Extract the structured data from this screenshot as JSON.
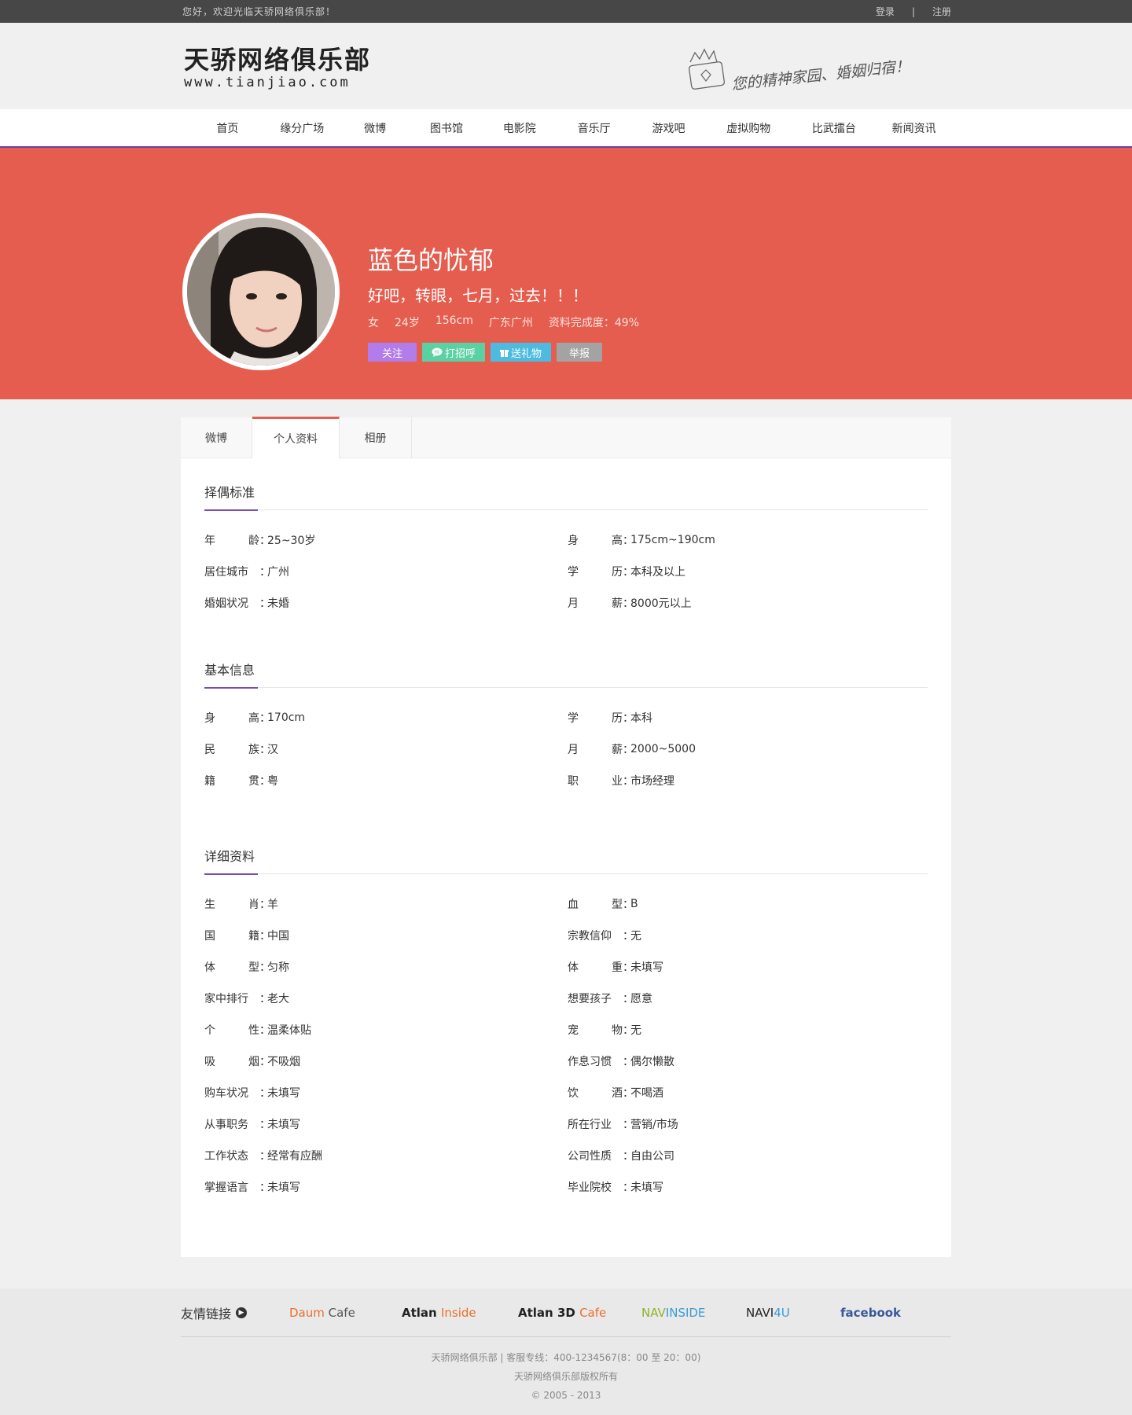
{
  "topbar": {
    "welcome": "您好，欢迎光临天骄网络俱乐部！",
    "login": "登录",
    "separator": "|",
    "register": "注册"
  },
  "header": {
    "logo_title": "天骄网络俱乐部",
    "logo_url": "www.tianjiao.com",
    "slogan": "您的精神家园、婚姻归宿！"
  },
  "nav": [
    "首页",
    "缘分广场",
    "微博",
    "图书馆",
    "电影院",
    "音乐厅",
    "游戏吧",
    "虚拟购物",
    "比武擂台",
    "新闻资讯"
  ],
  "profile": {
    "nickname": "蓝色的忧郁",
    "motto": "好吧，转眼，七月，过去！！！",
    "gender": "女",
    "age": "24岁",
    "height": "156cm",
    "location": "广东广州",
    "completeness": "资料完成度：49%",
    "actions": {
      "follow": "关注",
      "greet": "打招呼",
      "gift": "送礼物",
      "report": "举报"
    }
  },
  "tabs": [
    "微博",
    "个人资料",
    "相册"
  ],
  "sections": [
    {
      "title": "择偶标准",
      "items": [
        {
          "k": [
            "年",
            "龄"
          ],
          "v": "25~30岁"
        },
        {
          "k": [
            "身",
            "高"
          ],
          "v": "175cm~190cm"
        },
        {
          "k": [
            "居住城市"
          ],
          "v": "广州"
        },
        {
          "k": [
            "学",
            "历"
          ],
          "v": "本科及以上"
        },
        {
          "k": [
            "婚姻状况"
          ],
          "v": "未婚"
        },
        {
          "k": [
            "月",
            "薪"
          ],
          "v": "8000元以上"
        }
      ]
    },
    {
      "title": "基本信息",
      "items": [
        {
          "k": [
            "身",
            "高"
          ],
          "v": "170cm"
        },
        {
          "k": [
            "学",
            "历"
          ],
          "v": "本科"
        },
        {
          "k": [
            "民",
            "族"
          ],
          "v": "汉"
        },
        {
          "k": [
            "月",
            "薪"
          ],
          "v": "2000~5000"
        },
        {
          "k": [
            "籍",
            "贯"
          ],
          "v": "粤"
        },
        {
          "k": [
            "职",
            "业"
          ],
          "v": "市场经理"
        }
      ]
    },
    {
      "title": "详细资料",
      "items": [
        {
          "k": [
            "生",
            "肖"
          ],
          "v": "羊"
        },
        {
          "k": [
            "血",
            "型"
          ],
          "v": "B"
        },
        {
          "k": [
            "国",
            "籍"
          ],
          "v": "中国"
        },
        {
          "k": [
            "宗教信仰"
          ],
          "v": "无"
        },
        {
          "k": [
            "体",
            "型"
          ],
          "v": "匀称"
        },
        {
          "k": [
            "体",
            "重"
          ],
          "v": "未填写"
        },
        {
          "k": [
            "家中排行"
          ],
          "v": "老大"
        },
        {
          "k": [
            "想要孩子"
          ],
          "v": "愿意"
        },
        {
          "k": [
            "个",
            "性"
          ],
          "v": "温柔体贴"
        },
        {
          "k": [
            "宠",
            "物"
          ],
          "v": "无"
        },
        {
          "k": [
            "吸",
            "烟"
          ],
          "v": "不吸烟"
        },
        {
          "k": [
            "作息习惯"
          ],
          "v": "偶尔懒散"
        },
        {
          "k": [
            "购车状况"
          ],
          "v": "未填写"
        },
        {
          "k": [
            "饮",
            "酒"
          ],
          "v": "不喝酒"
        },
        {
          "k": [
            "从事职务"
          ],
          "v": "未填写"
        },
        {
          "k": [
            "所在行业"
          ],
          "v": "营销/市场"
        },
        {
          "k": [
            "工作状态"
          ],
          "v": "经常有应酬"
        },
        {
          "k": [
            "公司性质"
          ],
          "v": "自由公司"
        },
        {
          "k": [
            "掌握语言"
          ],
          "v": "未填写"
        },
        {
          "k": [
            "毕业院校"
          ],
          "v": "未填写"
        }
      ]
    }
  ],
  "footer": {
    "links_title": "友情链接",
    "partners": [
      {
        "a": "Daum",
        "b": " Cafe",
        "ca": "#e8702a",
        "cb": "#555"
      },
      {
        "a": "Atlan ",
        "b": "Inside",
        "ca": "#222",
        "cb": "#e8702a"
      },
      {
        "a": "Atlan 3D ",
        "b": "Cafe",
        "ca": "#222",
        "cb": "#e8702a"
      },
      {
        "a": "NAV",
        "b": "INSIDE",
        "ca": "#8db32b",
        "cb": "#3b9ad9"
      },
      {
        "a": "NAVI",
        "b": "4U",
        "ca": "#222",
        "cb": "#3b9ad9"
      },
      {
        "a": "facebook",
        "b": "",
        "ca": "#3b5998",
        "cb": "#3b5998"
      }
    ],
    "line1": "天骄网络俱乐部  |  客服专线：400-1234567(8：00 至 20：00)",
    "line2": "天骄网络俱乐部版权所有",
    "line3": "© 2005 - 2013"
  },
  "colors": {
    "banner": "#e55d4f",
    "accent": "#7b4bb2",
    "topbar": "#474747"
  }
}
